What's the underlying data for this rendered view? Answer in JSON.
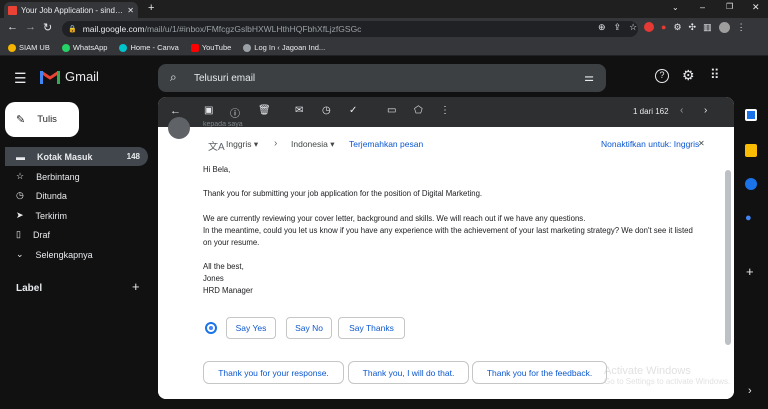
{
  "browser": {
    "tab_title": "Your Job Application - sindigsab",
    "url_host": "mail.google.com",
    "url_path": "/mail/u/1/#inbox/FMfcgzGslbHXWLHthHQFbhXfLjzfGSGc",
    "bookmarks": [
      {
        "label": "SIAM UB",
        "color": "#f4b400"
      },
      {
        "label": "WhatsApp",
        "color": "#25d366"
      },
      {
        "label": "Home - Canva",
        "color": "#00c4cc"
      },
      {
        "label": "YouTube",
        "color": "#ff0000"
      },
      {
        "label": "Log In ‹ Jagoan Ind...",
        "color": "#9aa0a6"
      }
    ]
  },
  "gmail": {
    "logo_text": "Gmail",
    "compose_label": "Tulis",
    "search_placeholder": "Telusuri email",
    "nav": [
      {
        "label": "Kotak Masuk",
        "count": "148",
        "icon": "inbox-icon"
      },
      {
        "label": "Berbintang",
        "count": "",
        "icon": "star-icon"
      },
      {
        "label": "Ditunda",
        "count": "",
        "icon": "clock-icon"
      },
      {
        "label": "Terkirim",
        "count": "",
        "icon": "send-icon"
      },
      {
        "label": "Draf",
        "count": "",
        "icon": "draft-icon"
      },
      {
        "label": "Selengkapnya",
        "count": "",
        "icon": "chevron-down-icon"
      }
    ],
    "label_header": "Label",
    "pager": "1 dari 162"
  },
  "translate": {
    "from_lang": "Inggris",
    "to_lang": "Indonesia",
    "translate_link": "Terjemahkan pesan",
    "disable_link": "Nonaktifkan untuk: Inggris"
  },
  "email": {
    "partial_header": "kepada saya",
    "greeting": "Hi Bela,",
    "p1": "Thank you for submitting your job application for the position of Digital Marketing.",
    "p2a": "We are currently reviewing your cover letter, background and skills. We will reach out if we have any questions.",
    "p2b": "In the meantime, could you let us know if you have any experience with the achievement of your last marketing strategy? We don't see it listed",
    "p2c": "on your resume.",
    "closing": "All the best,",
    "sig_name": "Jones",
    "sig_title": "HRD Manager"
  },
  "smart_replies": [
    "Say Yes",
    "Say No",
    "Say Thanks"
  ],
  "suggested_replies": [
    "Thank you for your response.",
    "Thank you, I will do that.",
    "Thank you for the feedback."
  ],
  "watermark": {
    "title": "Activate Windows",
    "subtitle": "Go to Settings to activate Windows."
  }
}
